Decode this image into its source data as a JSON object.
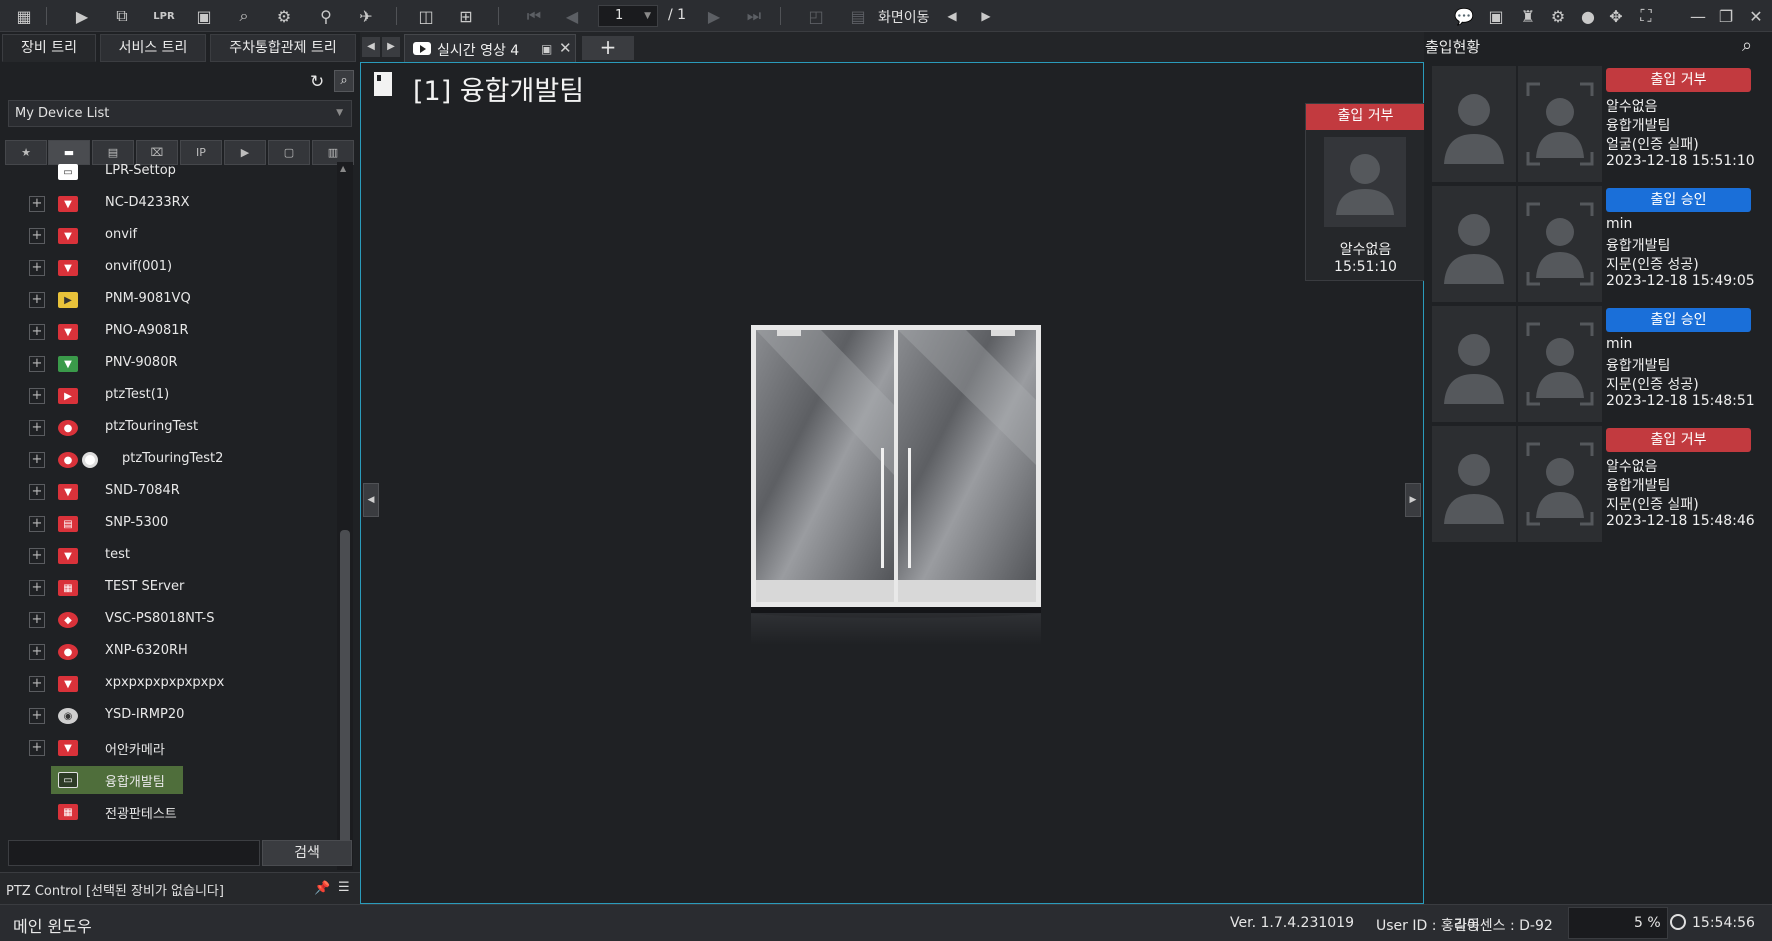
{
  "toolbar": {
    "icons": [
      "grid-menu-icon",
      "play-icon",
      "search-video-icon",
      "lpr-icon",
      "monitor-icon",
      "face-search-icon",
      "bike-icon",
      "map-search-icon",
      "megaphone-icon",
      "layout-icon",
      "add-screen-icon",
      "first-page-icon",
      "prev-page-icon",
      "next-page-icon",
      "last-page-icon",
      "screen-shift-icon",
      "calendar-icon",
      "prev-icon",
      "next-icon",
      "chat-icon",
      "message-icon",
      "alarm-icon",
      "settings-icon",
      "user-icon",
      "move-icon",
      "fullscreen-icon",
      "minimize-icon",
      "restore-icon",
      "close-icon"
    ],
    "lpr_text": "LPR",
    "page_current": "1",
    "page_total": "/ 1",
    "screen_nav_label": "화면이동"
  },
  "left_panel": {
    "tabs": [
      {
        "label": "장비 트리"
      },
      {
        "label": "서비스 트리"
      },
      {
        "label": "주차통합관제 트리"
      }
    ],
    "device_list_select": "My Device List",
    "filter_tabs": [
      "favorite",
      "folder",
      "server",
      "wired-device",
      "IP",
      "camera",
      "badge",
      "misc"
    ],
    "filter_ip_label": "IP",
    "tree": [
      {
        "label": "LPR-Settop",
        "color": "#ffffff",
        "has_plus": false
      },
      {
        "label": "NC-D4233RX",
        "color": "#d9323a",
        "has_plus": true
      },
      {
        "label": "onvif",
        "color": "#d9323a",
        "has_plus": true
      },
      {
        "label": "onvif(001)",
        "color": "#d9323a",
        "has_plus": true
      },
      {
        "label": "PNM-9081VQ",
        "color": "#e8c23a",
        "has_plus": true
      },
      {
        "label": "PNO-A9081R",
        "color": "#d9323a",
        "has_plus": true
      },
      {
        "label": "PNV-9080R",
        "color": "#3a9a4a",
        "has_plus": true
      },
      {
        "label": "ptzTest(1)",
        "color": "#d9323a",
        "has_plus": true
      },
      {
        "label": "ptzTouringTest",
        "color": "#d9323a",
        "has_plus": true
      },
      {
        "label": "ptzTouringTest2",
        "color": "#d9323a",
        "has_plus": true
      },
      {
        "label": "SND-7084R",
        "color": "#d9323a",
        "has_plus": true
      },
      {
        "label": "SNP-5300",
        "color": "#d9323a",
        "has_plus": true
      },
      {
        "label": "test",
        "color": "#d9323a",
        "has_plus": true
      },
      {
        "label": "TEST SErver",
        "color": "#d9323a",
        "has_plus": true
      },
      {
        "label": "VSC-PS8018NT-S",
        "color": "#d9323a",
        "has_plus": true
      },
      {
        "label": "XNP-6320RH",
        "color": "#d9323a",
        "has_plus": true
      },
      {
        "label": "xpxpxpxpxpxpxpx",
        "color": "#d9323a",
        "has_plus": true
      },
      {
        "label": "YSD-IRMP20",
        "color": "#cfcfcf",
        "has_plus": true
      },
      {
        "label": "어안카메라",
        "color": "#d9323a",
        "has_plus": true
      },
      {
        "label": "융합개발팀",
        "color": "#4f6e3b",
        "has_plus": false,
        "selected": true
      },
      {
        "label": "전광판테스트",
        "color": "#d9323a",
        "has_plus": false
      }
    ],
    "search_button": "검색",
    "ptz_status": "PTZ Control [선택된 장비가 없습니다]"
  },
  "center": {
    "tab_label": "실시간 영상 4",
    "add_tab": "+",
    "video_title": "[1] 융합개발팀",
    "popup": {
      "badge": "출입 거부",
      "badge_color": "#c23a3f",
      "name": "알수없음",
      "time": "15:51:10"
    }
  },
  "right_panel": {
    "title": "출입현황",
    "entries": [
      {
        "badge": "출입 거부",
        "badge_color": "#c23a3f",
        "name": "알수없음",
        "group": "융합개발팀",
        "method": "얼굴(인증 실패)",
        "datetime": "2023-12-18 15:51:10"
      },
      {
        "badge": "출입 승인",
        "badge_color": "#1a6fd9",
        "name": "min",
        "group": "융합개발팀",
        "method": "지문(인증 성공)",
        "datetime": "2023-12-18 15:49:05"
      },
      {
        "badge": "출입 승인",
        "badge_color": "#1a6fd9",
        "name": "min",
        "group": "융합개발팀",
        "method": "지문(인증 성공)",
        "datetime": "2023-12-18 15:48:51"
      },
      {
        "badge": "출입 거부",
        "badge_color": "#c23a3f",
        "name": "알수없음",
        "group": "융합개발팀",
        "method": "지문(인증 실패)",
        "datetime": "2023-12-18 15:48:46"
      }
    ]
  },
  "statusbar": {
    "main_window": "메인 윈도우",
    "version": "Ver. 1.7.4.231019",
    "user": "User ID : 홍길동",
    "license": "라이센스 : D-92",
    "cpu": "5 %",
    "clock": "15:54:56"
  }
}
